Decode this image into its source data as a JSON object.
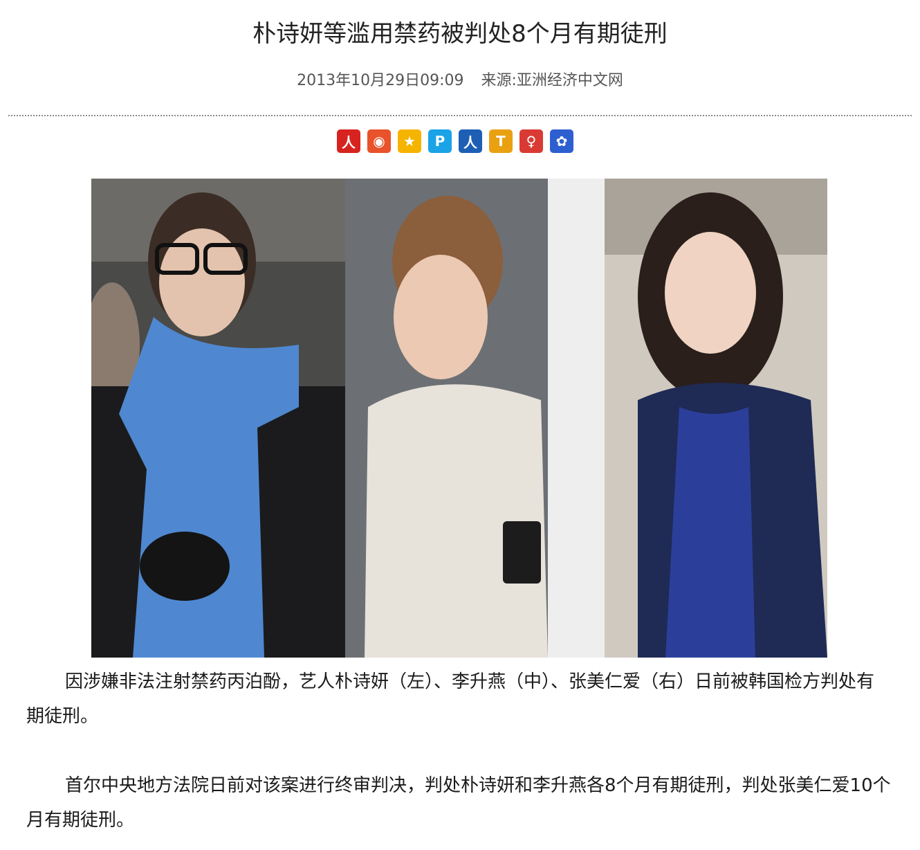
{
  "article": {
    "title": "朴诗妍等滥用禁药被判处8个月有期徒刑",
    "date": "2013年10月29日09:09",
    "source": "来源:亚洲经济中文网"
  },
  "share_icons": [
    {
      "name": "people-daily-icon",
      "glyph": "人",
      "color": "#d7231f"
    },
    {
      "name": "weibo-icon",
      "glyph": "◉",
      "color": "#e8532b"
    },
    {
      "name": "qzone-icon",
      "glyph": "★",
      "color": "#f5b400"
    },
    {
      "name": "tencent-weibo-icon",
      "glyph": "P",
      "color": "#1aa3e6"
    },
    {
      "name": "renren-icon",
      "glyph": "人",
      "color": "#1d5fb4"
    },
    {
      "name": "tianya-icon",
      "glyph": "T",
      "color": "#e9a112"
    },
    {
      "name": "kaixin-icon",
      "glyph": "♀",
      "color": "#d93b34"
    },
    {
      "name": "baidu-icon",
      "glyph": "✿",
      "color": "#2d5fd0"
    }
  ],
  "body": {
    "paragraph_1": "因涉嫌非法注射禁药丙泊酚，艺人朴诗妍（左）、李升燕（中）、张美仁爱（右）日前被韩国检方判处有期徒刑。",
    "paragraph_2": "首尔中央地方法院日前对该案进行终审判决，判处朴诗妍和李升燕各8个月有期徒刑，判处张美仁爱10个月有期徒刑。"
  }
}
